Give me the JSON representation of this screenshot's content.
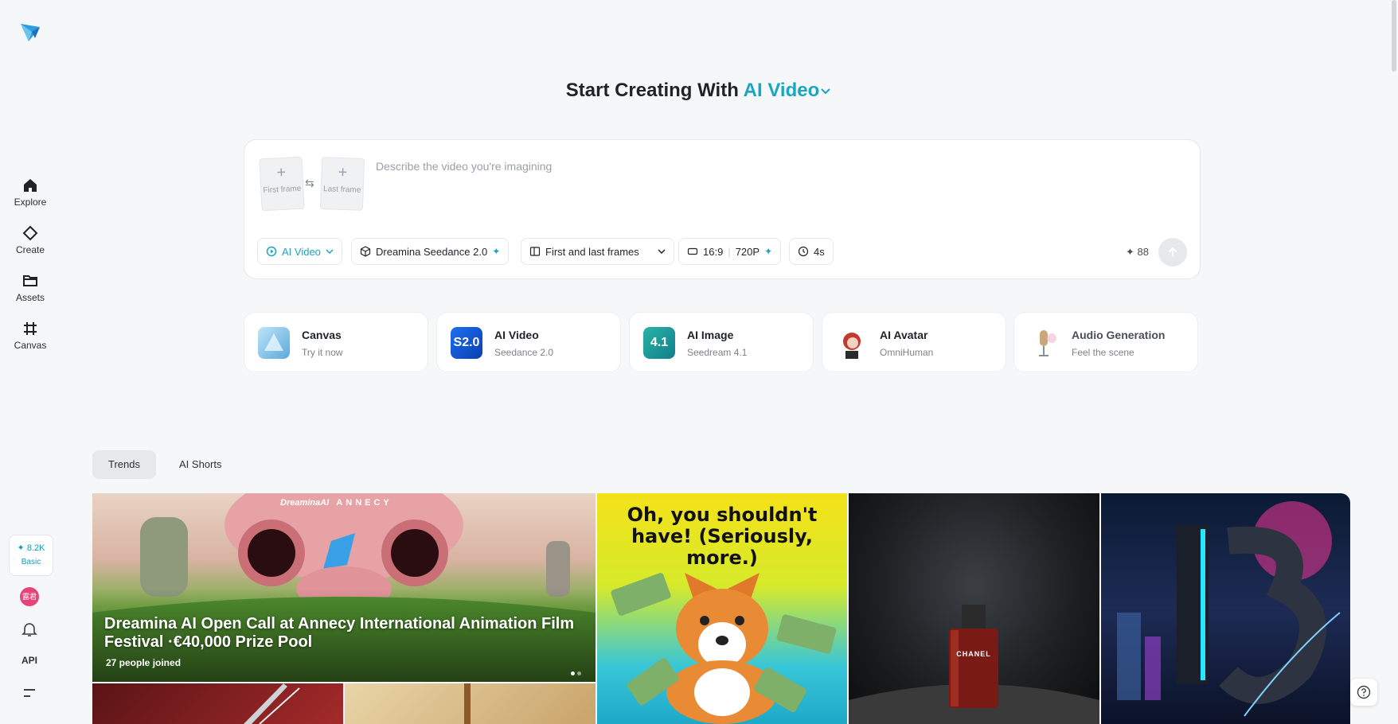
{
  "sidebar": {
    "items": [
      {
        "label": "Explore",
        "icon": "home-icon"
      },
      {
        "label": "Create",
        "icon": "diamond-icon"
      },
      {
        "label": "Assets",
        "icon": "folder-icon"
      },
      {
        "label": "Canvas",
        "icon": "canvas-icon"
      }
    ],
    "credits": {
      "value": "8.2K",
      "plan": "Basic"
    },
    "avatar_text": "露君",
    "api_label": "API"
  },
  "header": {
    "title_prefix": "Start Creating With",
    "title_mode": "AI Video"
  },
  "prompt": {
    "placeholder": "Describe the video you're imagining",
    "value": "",
    "first_frame_label": "First frame",
    "last_frame_label": "Last frame",
    "chips": {
      "mode": "AI Video",
      "model": "Dreamina Seedance 2.0",
      "frames": "First and last frames",
      "ratio": "16:9",
      "resolution": "720P",
      "duration": "4s"
    },
    "credit_cost": "88"
  },
  "tools": [
    {
      "name": "Canvas",
      "sub": "Try it now",
      "thumb_text": ""
    },
    {
      "name": "AI Video",
      "sub": "Seedance 2.0",
      "thumb_text": "S2.0"
    },
    {
      "name": "AI Image",
      "sub": "Seedream 4.1",
      "thumb_text": "4.1"
    },
    {
      "name": "AI Avatar",
      "sub": "OmniHuman",
      "thumb_text": ""
    },
    {
      "name": "Audio Generation",
      "sub": "Feel the scene",
      "thumb_text": ""
    }
  ],
  "tabs": [
    {
      "label": "Trends"
    },
    {
      "label": "AI Shorts"
    }
  ],
  "gallery": {
    "banner": {
      "brand": "DreaminaAI",
      "partner": "ANNECY",
      "title": "Dreamina AI Open Call at Annecy International Animation Film Festival ·€40,000 Prize Pool",
      "joined": "27  people joined"
    },
    "corgi_caption": "Oh, you shouldn't have! (Seriously, more.)",
    "perfume_label": "CHANEL"
  },
  "colors": {
    "accent": "#1aa5c2",
    "background": "#f6f7f9"
  }
}
